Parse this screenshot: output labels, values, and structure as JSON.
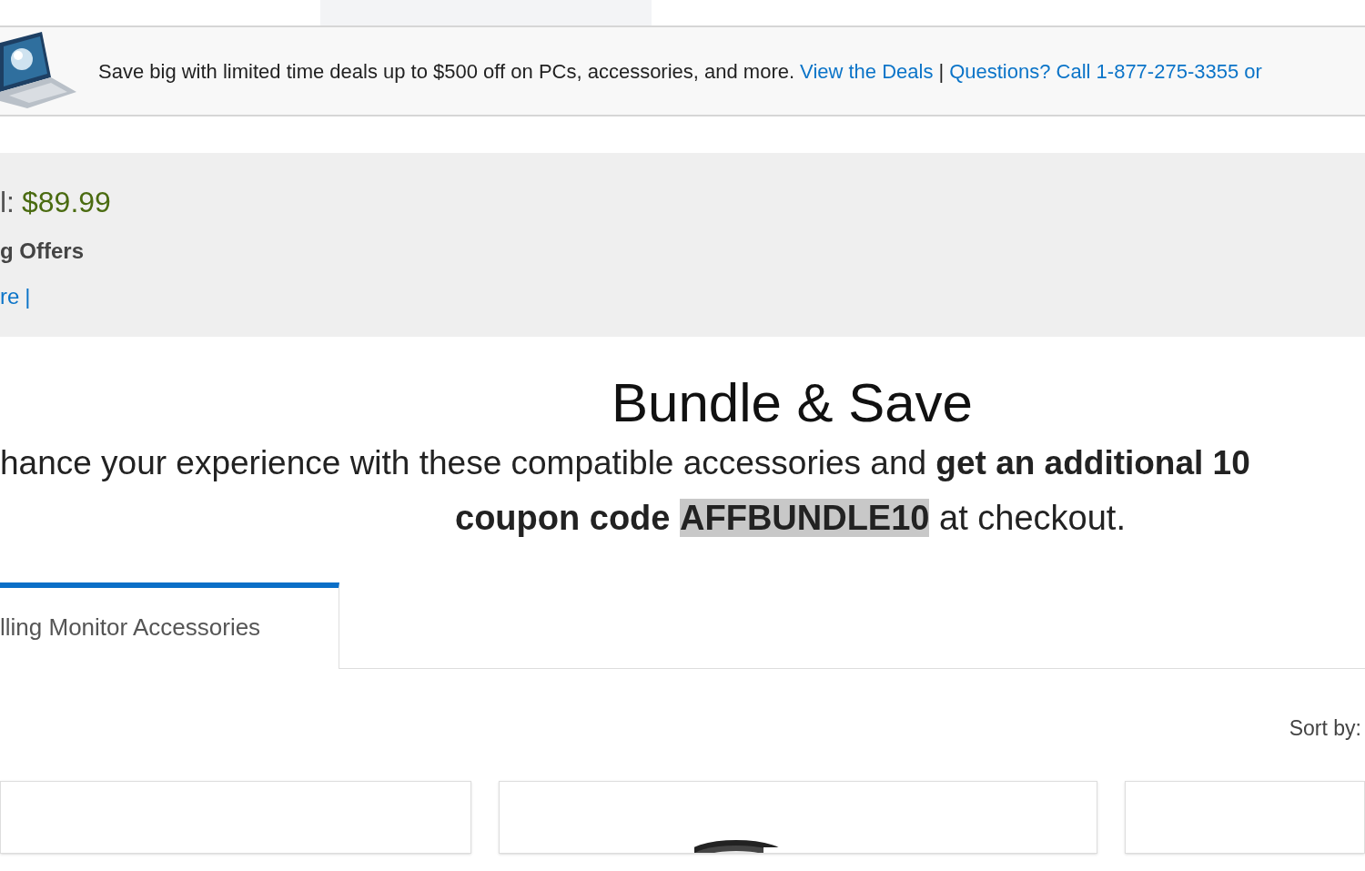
{
  "promo_banner": {
    "kind": "picture",
    "text": "Save big with limited time deals up to $500 off on PCs, accessories, and more.",
    "links": [
      {
        "label": "View the Deals"
      },
      {
        "label": "Questions? Call 1-877-275-3355 or"
      }
    ],
    "separator": "|"
  },
  "summary": {
    "total_label": "l:",
    "total_price": "$89.99",
    "offers_heading": "g Offers",
    "link": "re",
    "separator": "|"
  },
  "bundle": {
    "title": "Bundle & Save",
    "line_1": "hance your experience with these compatible accessories and **get an additional 10**",
    "line_2": {
      "before": "coupon code",
      "code": "AFFBUNDLE10",
      "after": "at checkout."
    }
  },
  "tabs": [
    {
      "label": "lling Monitor Accessories",
      "selected": true
    }
  ],
  "sort_label": "Sort by:",
  "cards": [
    {
      "kind": "empty"
    },
    {
      "kind": "picture"
    },
    {
      "kind": "empty"
    }
  ]
}
